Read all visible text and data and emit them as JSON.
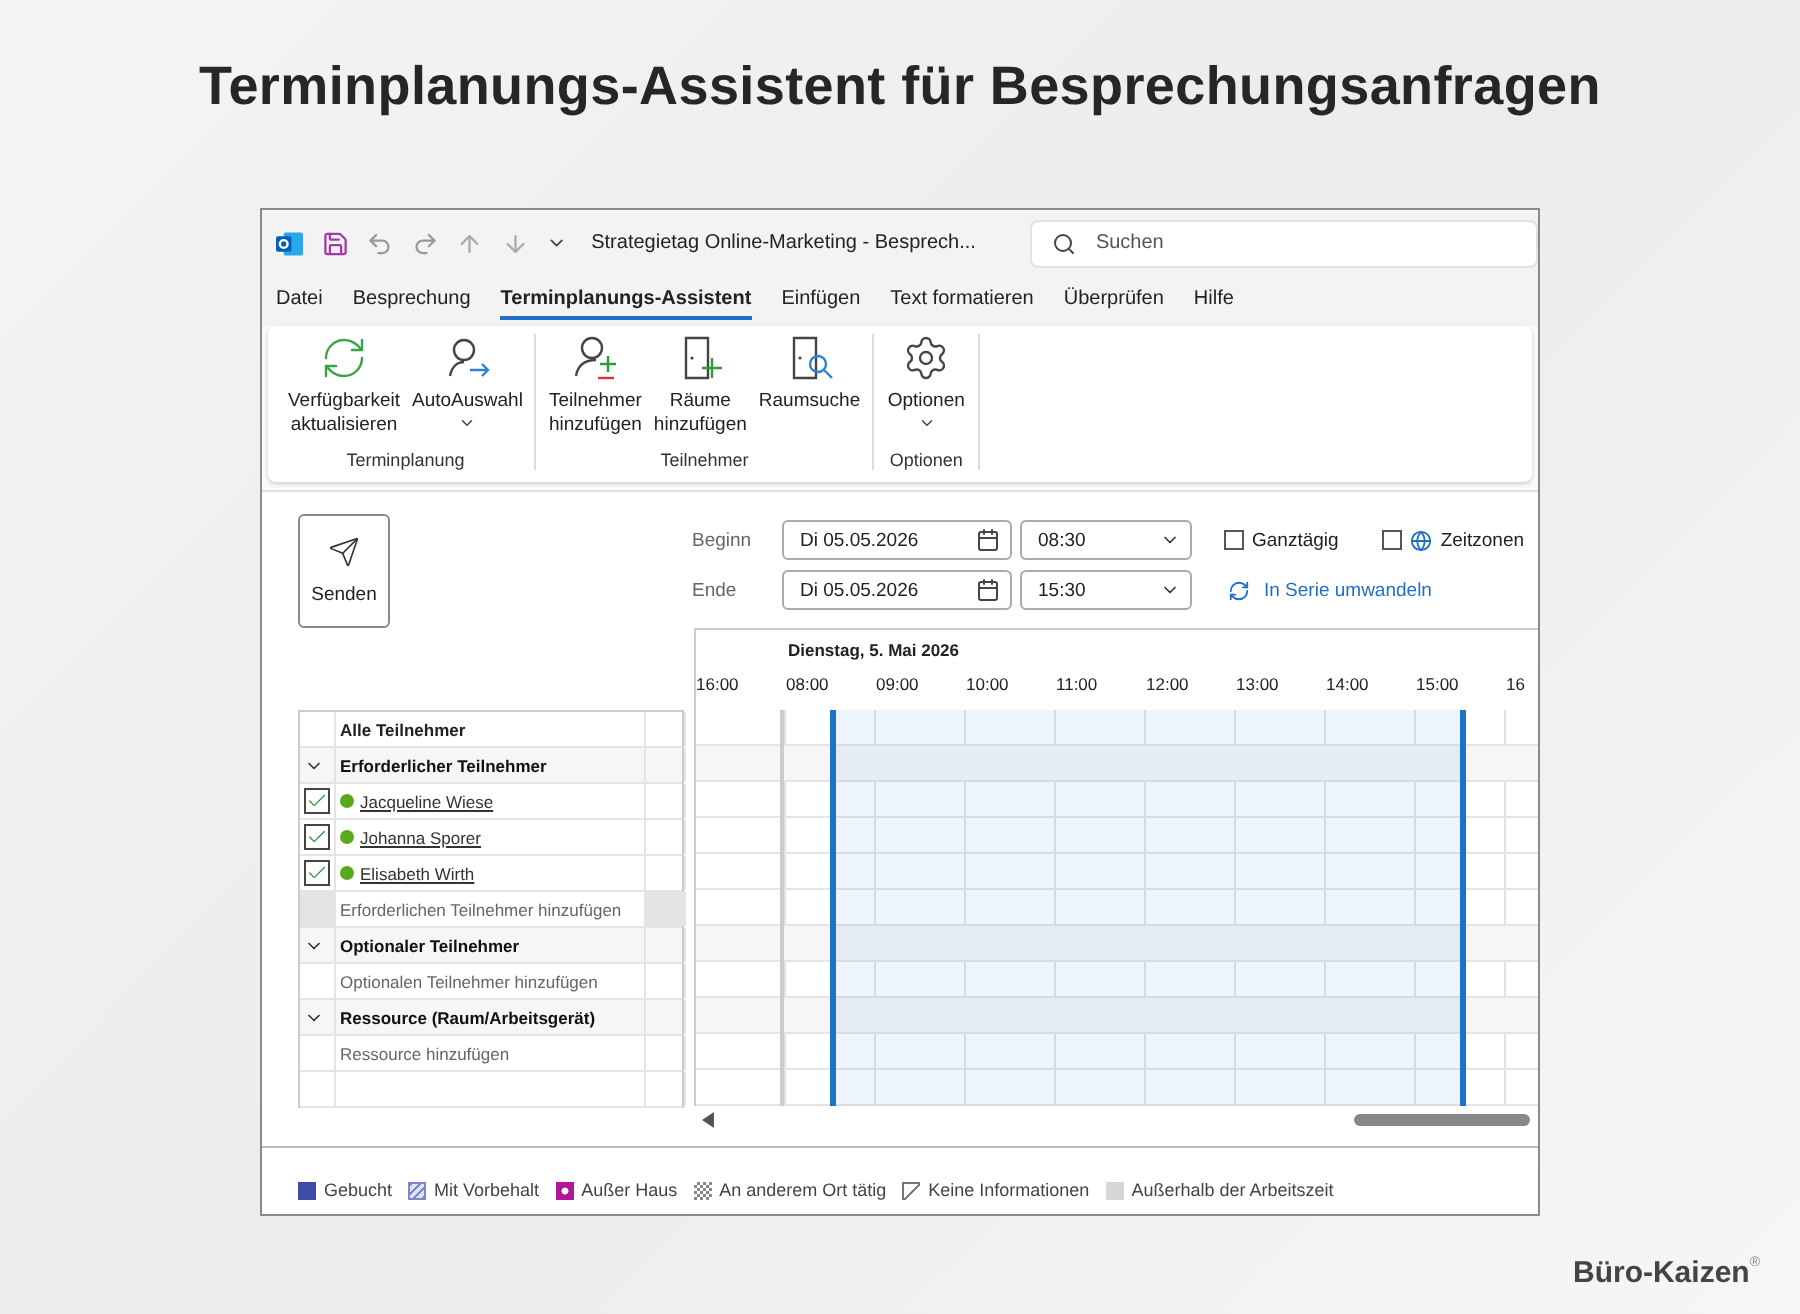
{
  "headline": "Terminplanungs-Assistent für Besprechungsanfragen",
  "window": {
    "title": "Strategietag Online-Marketing  -  Besprech...",
    "search": {
      "placeholder": "Suchen"
    }
  },
  "menu": [
    {
      "label": "Datei",
      "selected": false
    },
    {
      "label": "Besprechung",
      "selected": false
    },
    {
      "label": "Terminplanungs-Assistent",
      "selected": true
    },
    {
      "label": "Einfügen",
      "selected": false
    },
    {
      "label": "Text formatieren",
      "selected": false
    },
    {
      "label": "Überprüfen",
      "selected": false
    },
    {
      "label": "Hilfe",
      "selected": false
    }
  ],
  "ribbon": [
    {
      "label": "Terminplanung",
      "buttons": [
        {
          "kind": "refresh",
          "lines": [
            "Verfügbarkeit",
            "aktualisieren"
          ],
          "dropdown": false
        },
        {
          "kind": "autopick",
          "lines": [
            "AutoAuswahl"
          ],
          "dropdown": true
        }
      ]
    },
    {
      "label": "Teilnehmer",
      "buttons": [
        {
          "kind": "person",
          "lines": [
            "Teilnehmer",
            "hinzufügen"
          ],
          "dropdown": false
        },
        {
          "kind": "room",
          "lines": [
            "Räume",
            "hinzufügen"
          ],
          "dropdown": false
        },
        {
          "kind": "roomsearch",
          "lines": [
            "Raumsuche"
          ],
          "dropdown": false
        }
      ]
    },
    {
      "label": "Optionen",
      "buttons": [
        {
          "kind": "gear",
          "lines": [
            "Optionen"
          ],
          "dropdown": true
        }
      ]
    }
  ],
  "send": {
    "label": "Senden"
  },
  "begin": {
    "label": "Beginn",
    "date": "Di 05.05.2026",
    "time": "08:30"
  },
  "end": {
    "label": "Ende",
    "date": "Di 05.05.2026",
    "time": "15:30"
  },
  "all_day": {
    "label": "Ganztägig",
    "checked": false
  },
  "time_zones": {
    "label": "Zeitzonen",
    "checked": false
  },
  "recurrence": {
    "label": "In Serie umwandeln"
  },
  "timeline": {
    "date": "Dienstag, 5. Mai 2026",
    "hours": [
      "16:00",
      "08:00",
      "09:00",
      "10:00",
      "11:00",
      "12:00",
      "13:00",
      "14:00",
      "15:00",
      "16"
    ]
  },
  "attendees": {
    "header": "Alle Teilnehmer",
    "rows": [
      {
        "kind": "group",
        "label": "Erforderlicher Teilnehmer",
        "expanded": true
      },
      {
        "kind": "person",
        "label": "Jacqueline Wiese",
        "checked": true
      },
      {
        "kind": "person",
        "label": "Johanna Sporer",
        "checked": true
      },
      {
        "kind": "person",
        "label": "Elisabeth Wirth",
        "checked": true
      },
      {
        "kind": "add",
        "label": "Erforderlichen Teilnehmer hinzufügen",
        "selected": true
      },
      {
        "kind": "group",
        "label": "Optionaler Teilnehmer",
        "expanded": true
      },
      {
        "kind": "add",
        "label": "Optionalen Teilnehmer hinzufügen",
        "selected": false
      },
      {
        "kind": "group",
        "label": "Ressource (Raum/Arbeitsgerät)",
        "expanded": true
      },
      {
        "kind": "add",
        "label": "Ressource hinzufügen",
        "selected": false
      }
    ]
  },
  "legend": [
    {
      "kind": "busy",
      "label": "Gebucht"
    },
    {
      "kind": "tentative",
      "label": "Mit Vorbehalt"
    },
    {
      "kind": "away",
      "label": "Außer Haus"
    },
    {
      "kind": "elsewhere",
      "label": "An anderem Ort tätig"
    },
    {
      "kind": "noinfo",
      "label": "Keine Informationen"
    },
    {
      "kind": "offhours",
      "label": "Außerhalb der Arbeitszeit"
    }
  ],
  "brand": {
    "name": "Büro-Kaizen",
    "mark": "®"
  }
}
